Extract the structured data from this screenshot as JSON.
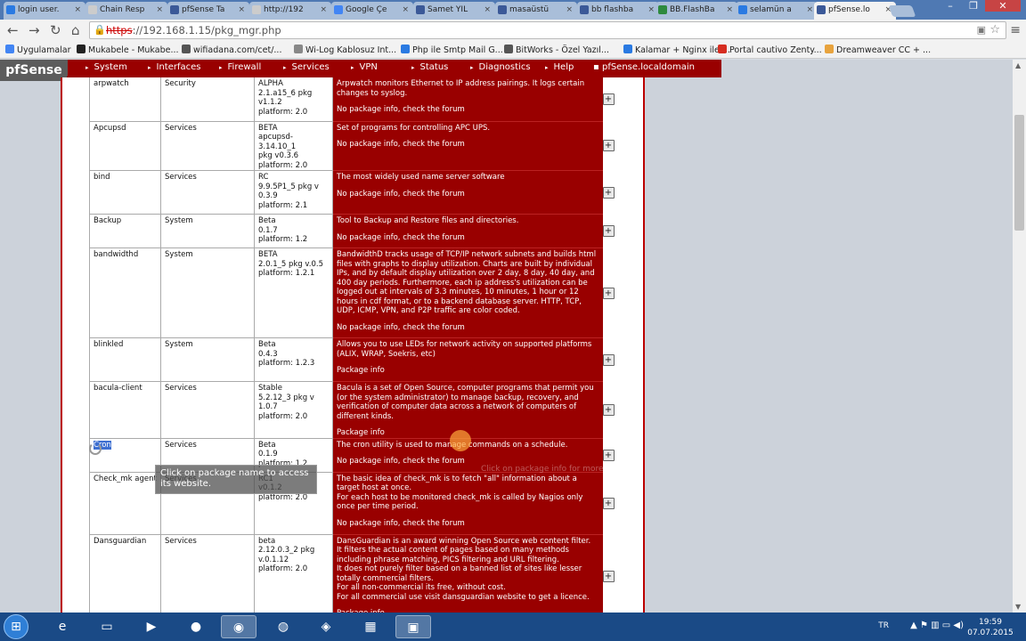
{
  "browser": {
    "tabs": [
      {
        "title": "login user.",
        "color": "#2a7ae2"
      },
      {
        "title": "Chain Resp",
        "color": "#cccccc"
      },
      {
        "title": "pfSense Ta",
        "color": "#3b5998"
      },
      {
        "title": "http://192",
        "color": "#cccccc"
      },
      {
        "title": "Google Çe",
        "color": "#4285f4"
      },
      {
        "title": "Samet YIL",
        "color": "#3b5998"
      },
      {
        "title": "masaüstü",
        "color": "#3b5998"
      },
      {
        "title": "bb flashba",
        "color": "#3b5998"
      },
      {
        "title": "BB.FlashBa",
        "color": "#2d8a3e"
      },
      {
        "title": "selamün a",
        "color": "#2a7ae2"
      },
      {
        "title": "pfSense.lo",
        "color": "#3b5998"
      }
    ],
    "url_scheme": "https",
    "url_rest": "://192.168.1.15/pkg_mgr.php",
    "bookmarks": [
      {
        "label": "Uygulamalar",
        "color": "#4285f4"
      },
      {
        "label": "Mukabele - Mukabe...",
        "color": "#222222"
      },
      {
        "label": "wifiadana.com/cet/...",
        "color": "#555555"
      },
      {
        "label": "Wi-Log Kablosuz Int...",
        "color": "#888888"
      },
      {
        "label": "Php ile Smtp Mail G...",
        "color": "#2a7ae2"
      },
      {
        "label": "BitWorks - Özel Yazıl...",
        "color": "#555555"
      },
      {
        "label": "Kalamar + Nginx ile ...",
        "color": "#2a7ae2"
      },
      {
        "label": "Portal cautivo Zenty...",
        "color": "#d62d20"
      },
      {
        "label": "Dreamweaver CC + ...",
        "color": "#e8a33d"
      }
    ]
  },
  "pfsense": {
    "logo": "Sense",
    "menu": [
      "System",
      "Interfaces",
      "Firewall",
      "Services",
      "VPN",
      "Status",
      "Diagnostics",
      "Help"
    ],
    "hostname": "pfSense.localdomain",
    "packages": [
      {
        "name": "arpwatch",
        "category": "Security",
        "version": "ALPHA\n2.1.a15_6 pkg\nv1.1.2\nplatform: 2.0",
        "description": "Arpwatch monitors Ethernet to IP address pairings. It logs certain changes to syslog.",
        "info": "No package info, check the forum"
      },
      {
        "name": "Apcupsd",
        "category": "Services",
        "version": "BETA\napcupsd-3.14.10_1\npkg v0.3.6\nplatform: 2.0",
        "description": "Set of programs for controlling APC UPS.",
        "info": "No package info, check the forum"
      },
      {
        "name": "bind",
        "category": "Services",
        "version": "RC\n9.9.5P1_5 pkg v\n0.3.9\nplatform: 2.1",
        "description": "The most widely used name server software",
        "info": "No package info, check the forum"
      },
      {
        "name": "Backup",
        "category": "System",
        "version": "Beta\n0.1.7\nplatform: 1.2",
        "description": "Tool to Backup and Restore files and directories.",
        "info": "No package info, check the forum"
      },
      {
        "name": "bandwidthd",
        "category": "System",
        "version": "BETA\n2.0.1_5 pkg v.0.5\nplatform: 1.2.1",
        "description": "BandwidthD tracks usage of TCP/IP network subnets and builds html files with graphs to display utilization. Charts are built by individual IPs, and by default display utilization over 2 day, 8 day, 40 day, and 400 day periods. Furthermore, each ip address's utilization can be logged out at intervals of 3.3 minutes, 10 minutes, 1 hour or 12 hours in cdf format, or to a backend database server. HTTP, TCP, UDP, ICMP, VPN, and P2P traffic are color coded.",
        "info": "No package info, check the forum"
      },
      {
        "name": "blinkled",
        "category": "System",
        "version": "Beta\n0.4.3\nplatform: 1.2.3",
        "description": "Allows you to use LEDs for network activity on supported platforms (ALIX, WRAP, Soekris, etc)",
        "info": "Package info"
      },
      {
        "name": "bacula-client",
        "category": "Services",
        "version": "Stable\n5.2.12_3 pkg v\n1.0.7\nplatform: 2.0",
        "description": "Bacula is a set of Open Source, computer programs that permit you (or the system administrator) to manage backup, recovery, and verification of computer data across a network of computers of different kinds.",
        "info": "Package info"
      },
      {
        "name": "Cron",
        "category": "Services",
        "version": "Beta\n0.1.9\nplatform: 1.2",
        "description": "The cron utility is used to manage commands on a schedule.",
        "info": "No package info, check the forum"
      },
      {
        "name": "Check_mk agent",
        "category": "Services",
        "version": "RC1\nv0.1.2\nplatform: 2.0",
        "description": "The basic idea of check_mk is to fetch \"all\" information about a target host at once.\nFor each host to be monitored check_mk is called by Nagios only once per time period.",
        "info": "No package info, check the forum"
      },
      {
        "name": "Dansguardian",
        "category": "Services",
        "version": "beta\n2.12.0.3_2 pkg\nv.0.1.12\nplatform: 2.0",
        "description": "DansGuardian is an award winning Open Source web content filter.\nIt filters the actual content of pages based on many methods including phrase matching, PICS filtering and URL filtering.\nIt does not purely filter based on a banned list of sites like lesser totally commercial filters.\nFor all non-commercial its free, without cost.\nFor all commercial use visit dansguardian website to get a licence.",
        "info": "Package info"
      }
    ],
    "tooltip": "Click on package name to access its website.",
    "ghost_tip": "Click on package info for more details"
  },
  "taskbar": {
    "lang": "TR",
    "time": "19:59",
    "date": "07.07.2015"
  }
}
